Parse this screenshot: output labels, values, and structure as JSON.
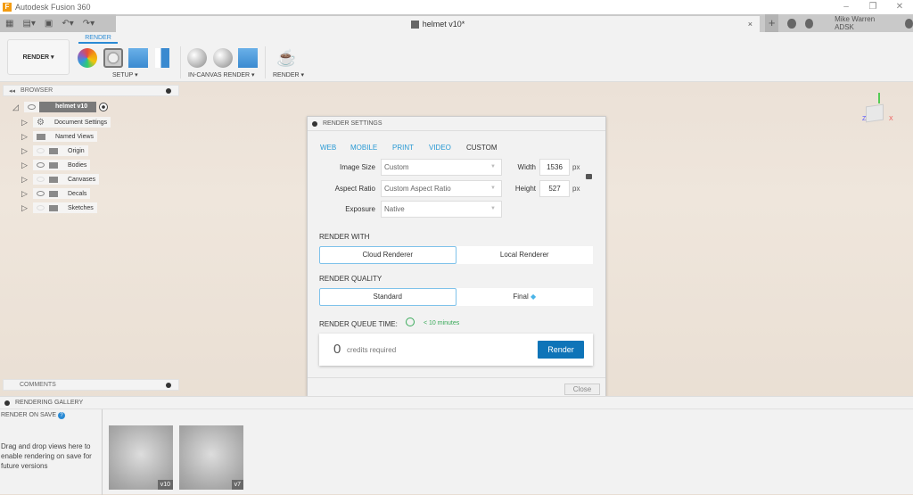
{
  "app": {
    "title": "Autodesk Fusion 360",
    "logo": "F"
  },
  "window_controls": [
    "–",
    "❐",
    "✕"
  ],
  "document": {
    "tab_title": "helmet v10*",
    "close": "×"
  },
  "user": {
    "name": "Mike Warren ADSK"
  },
  "ribbon": {
    "workspace": "RENDER ▾",
    "active_tab": "RENDER",
    "groups": [
      "SETUP ▾",
      "IN-CANVAS RENDER ▾",
      "RENDER ▾"
    ]
  },
  "browser": {
    "title": "BROWSER",
    "root": "helmet v10",
    "items": [
      {
        "label": "Document Settings",
        "icon": "gear-icon",
        "eye": "none"
      },
      {
        "label": "Named Views",
        "icon": "folder-icon",
        "eye": "none"
      },
      {
        "label": "Origin",
        "icon": "folder-icon",
        "eye": "off"
      },
      {
        "label": "Bodies",
        "icon": "folder-icon",
        "eye": "on"
      },
      {
        "label": "Canvases",
        "icon": "folder-icon",
        "eye": "off"
      },
      {
        "label": "Decals",
        "icon": "folder-icon",
        "eye": "on"
      },
      {
        "label": "Sketches",
        "icon": "folder-icon",
        "eye": "off"
      }
    ]
  },
  "comments": {
    "title": "COMMENTS"
  },
  "render_settings": {
    "title": "RENDER SETTINGS",
    "presets": [
      "WEB",
      "MOBILE",
      "PRINT",
      "VIDEO",
      "CUSTOM"
    ],
    "active_preset": "CUSTOM",
    "image_size_label": "Image Size",
    "image_size": "Custom",
    "aspect_ratio_label": "Aspect Ratio",
    "aspect_ratio": "Custom Aspect Ratio",
    "exposure_label": "Exposure",
    "exposure": "Native",
    "width_label": "Width",
    "width": "1536",
    "height_label": "Height",
    "height": "527",
    "unit": "px",
    "render_with_label": "RENDER WITH",
    "render_with": [
      "Cloud Renderer",
      "Local Renderer"
    ],
    "render_quality_label": "RENDER QUALITY",
    "render_quality": [
      "Standard",
      "Final"
    ],
    "queue_label": "RENDER QUEUE TIME:",
    "queue_time": "< 10 minutes",
    "credits": "0",
    "credits_label": "credits required",
    "render_button": "Render",
    "close_button": "Close"
  },
  "gallery": {
    "title": "RENDERING GALLERY",
    "render_on_save": "RENDER ON SAVE",
    "help": "?",
    "hint": "Drag and drop views here to enable rendering on save for future versions",
    "thumbnails": [
      {
        "version": "v10"
      },
      {
        "version": "v7"
      }
    ]
  },
  "viewcube": {
    "axes": [
      "Y",
      "Z",
      "X"
    ]
  },
  "colors": {
    "accent": "#2a8ad4",
    "render_button": "#0e74b8",
    "queue_time": "#3aaa5a"
  }
}
